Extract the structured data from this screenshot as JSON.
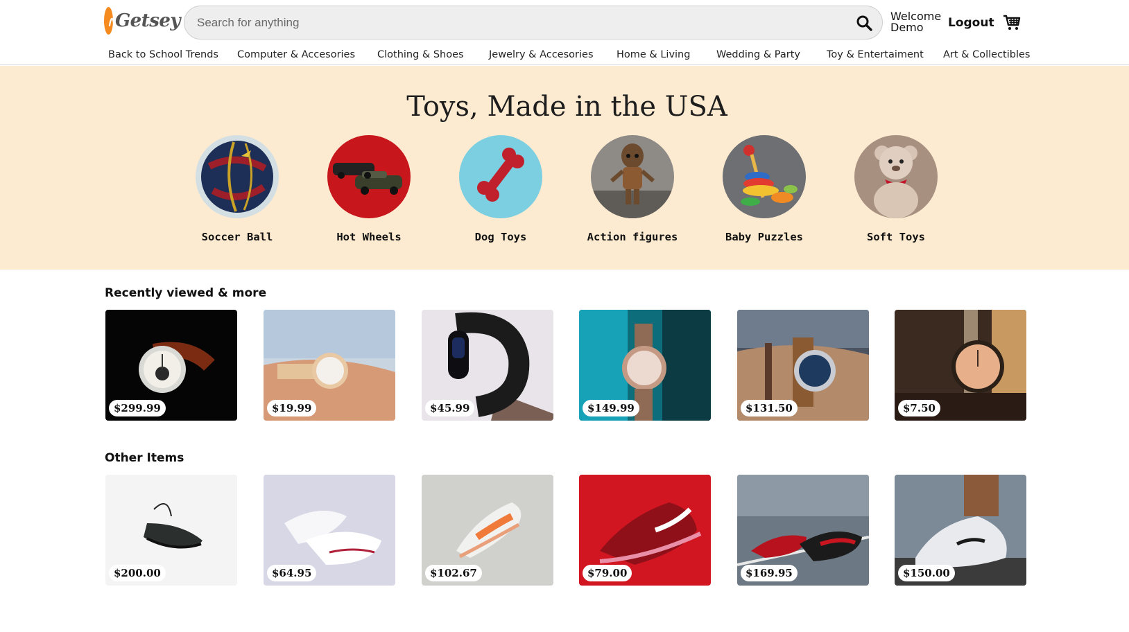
{
  "brand": {
    "logo_text": "Getsey",
    "accent": "#f58b1f"
  },
  "search": {
    "placeholder": "Search for anything",
    "value": ""
  },
  "header": {
    "welcome_line1": "Welcome",
    "welcome_line2": "Demo",
    "logout_label": "Logout"
  },
  "nav": {
    "items": [
      "Back to School Trends",
      "Computer & Accesories",
      "Clothing & Shoes",
      "Jewelry & Accesories",
      "Home & Living",
      "Wedding & Party",
      "Toy & Entertaiment",
      "Art & Collectibles"
    ]
  },
  "banner": {
    "title": "Toys, Made in the USA",
    "background": "#fdebd1",
    "categories": [
      {
        "label": "Soccer Ball"
      },
      {
        "label": "Hot Wheels"
      },
      {
        "label": "Dog Toys"
      },
      {
        "label": "Action figures"
      },
      {
        "label": "Baby Puzzles"
      },
      {
        "label": "Soft Toys"
      }
    ]
  },
  "recent": {
    "title": "Recently viewed & more",
    "items": [
      {
        "price": "$299.99"
      },
      {
        "price": "$19.99"
      },
      {
        "price": "$45.99"
      },
      {
        "price": "$149.99"
      },
      {
        "price": "$131.50"
      },
      {
        "price": "$7.50"
      }
    ]
  },
  "other": {
    "title": "Other Items",
    "items": [
      {
        "price": "$200.00"
      },
      {
        "price": "$64.95"
      },
      {
        "price": "$102.67"
      },
      {
        "price": "$79.00"
      },
      {
        "price": "$169.95"
      },
      {
        "price": "$150.00"
      }
    ]
  }
}
